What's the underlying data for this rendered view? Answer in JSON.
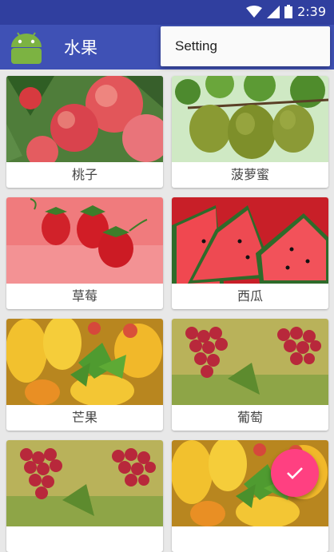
{
  "status_bar": {
    "time": "2:39"
  },
  "app_bar": {
    "title": "水果"
  },
  "popup_menu": {
    "items": [
      "Setting"
    ]
  },
  "fruits": [
    {
      "label": "桃子",
      "image": "peach"
    },
    {
      "label": "菠萝蜜",
      "image": "jackfruit"
    },
    {
      "label": "草莓",
      "image": "strawberry"
    },
    {
      "label": "西瓜",
      "image": "watermelon"
    },
    {
      "label": "芒果",
      "image": "mango"
    },
    {
      "label": "葡萄",
      "image": "grape"
    },
    {
      "label": "",
      "image": "grape"
    },
    {
      "label": "",
      "image": "mango"
    }
  ],
  "fab": {
    "icon": "check-icon"
  },
  "colors": {
    "primary": "#3f51b5",
    "primary_dark": "#303f9f",
    "accent": "#ff4081"
  }
}
